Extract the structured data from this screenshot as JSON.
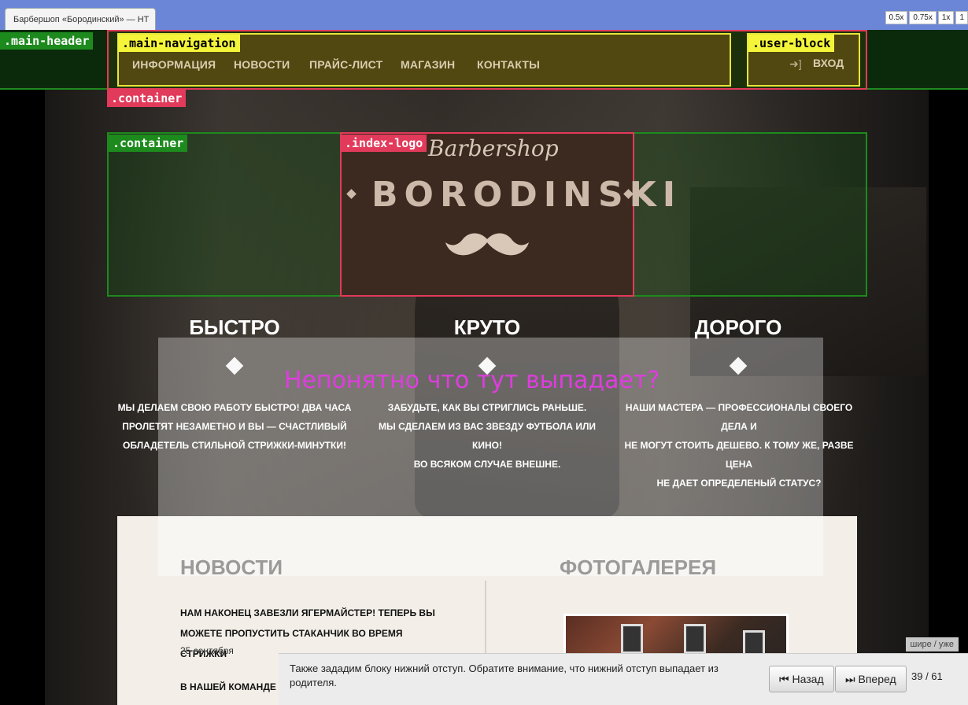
{
  "browser": {
    "tab_title": "Барбершоп «Бородинский» — HT",
    "zoom_options": [
      "0.5x",
      "0.75x",
      "1x",
      "1"
    ]
  },
  "debug_labels": {
    "main_header": ".main-header",
    "main_navigation": ".main-navigation",
    "user_block": ".user-block",
    "container_1": ".container",
    "container_2": ".container",
    "index_logo": ".index-logo"
  },
  "nav": {
    "items": [
      "ИНФОРМАЦИЯ",
      "НОВОСТИ",
      "ПРАЙС-ЛИСТ",
      "МАГАЗИН",
      "КОНТАКТЫ"
    ],
    "login_label": "ВХОД"
  },
  "logo": {
    "script_text": "Barbershop",
    "main_text": "BORODINSKI"
  },
  "features": [
    {
      "title": "БЫСТРО",
      "lines": [
        "МЫ ДЕЛАЕМ СВОЮ РАБОТУ БЫСТРО! ДВА ЧАСА",
        "ПРОЛЕТЯТ НЕЗАМЕТНО И ВЫ — СЧАСТЛИВЫЙ",
        "ОБЛАДЕТЕЛЬ СТИЛЬНОЙ СТРИЖКИ-МИНУТКИ!"
      ]
    },
    {
      "title": "КРУТО",
      "lines": [
        "ЗАБУДЬТЕ, КАК ВЫ СТРИГЛИСЬ РАНЬШЕ.",
        "МЫ СДЕЛАЕМ ИЗ ВАС ЗВЕЗДУ ФУТБОЛА ИЛИ КИНО!",
        "ВО ВСЯКОМ СЛУЧАЕ ВНЕШНЕ."
      ]
    },
    {
      "title": "ДОРОГО",
      "lines": [
        "НАШИ МАСТЕРА — ПРОФЕССИОНАЛЫ СВОЕГО ДЕЛА И",
        "НЕ МОГУТ СТОИТЬ ДЕШЕВО. К ТОМУ ЖЕ, РАЗВЕ ЦЕНА",
        "НЕ ДАЕТ ОПРЕДЕЛЕНЫЙ СТАТУС?"
      ]
    }
  ],
  "question_text": "Непонятно что тут выпадает?",
  "news": {
    "title": "НОВОСТИ",
    "items": [
      {
        "title_lines": [
          "НАМ НАКОНЕЦ ЗАВЕЗЛИ ЯГЕРМАЙСТЕР! ТЕПЕРЬ ВЫ",
          "МОЖЕТЕ ПРОПУСТИТЬ СТАКАНЧИК ВО ВРЕМЯ СТРИЖКИ"
        ],
        "date": "25 сентября"
      },
      {
        "title_lines": [
          "В НАШЕЙ КОМАНДЕ ПОПОЛНЕНИЕ, БОРИС «БРИТВА»"
        ],
        "date": ""
      }
    ]
  },
  "gallery": {
    "title": "ФОТОГАЛЕРЕЯ"
  },
  "tutorial": {
    "wider_narrower": "шире / уже",
    "hint": "Также зададим блоку нижний отступ. Обратите внимание, что нижний отступ выпадает из родителя.",
    "back_label": "Назад",
    "forward_label": "Вперед",
    "counter": "39 / 61"
  }
}
